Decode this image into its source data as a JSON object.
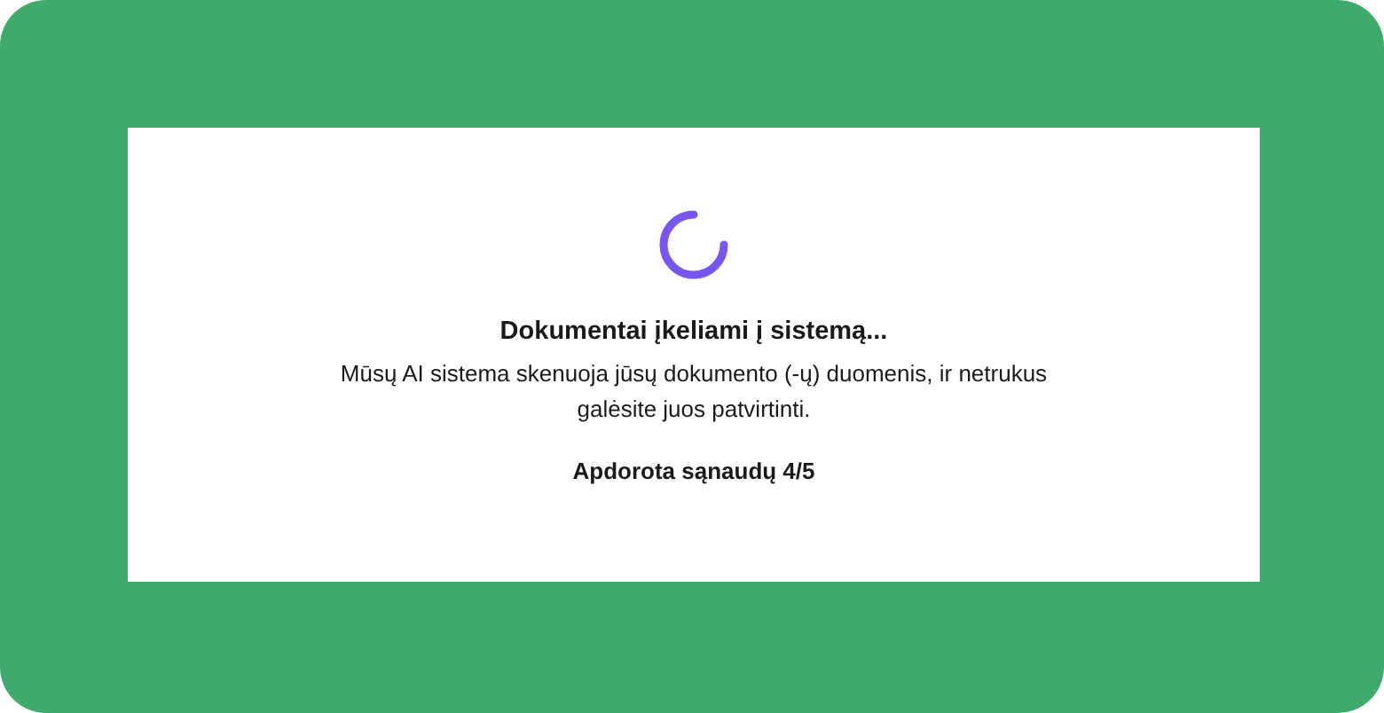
{
  "dialog": {
    "title": "Dokumentai įkeliami į sistemą...",
    "message": "Mūsų AI sistema skenuoja jūsų dokumento (-ų) duomenis, ir netrukus galėsite juos patvirtinti.",
    "progress": "Apdorota sąnaudų 4/5"
  }
}
